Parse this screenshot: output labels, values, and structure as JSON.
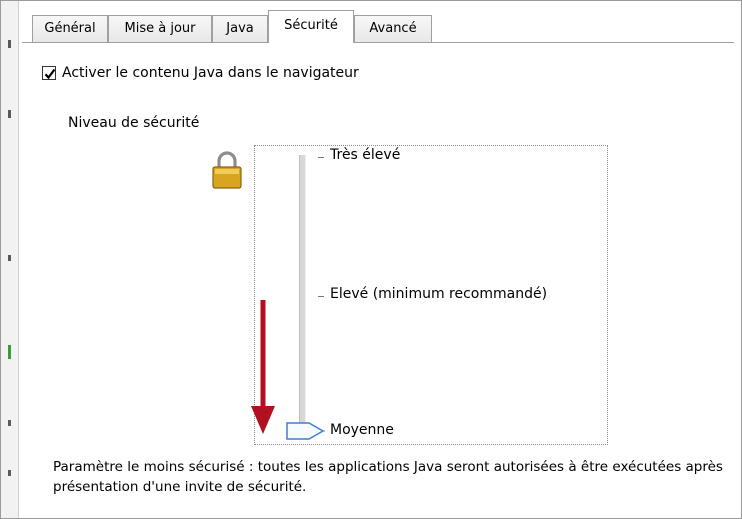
{
  "tabs": [
    {
      "label": "Général",
      "active": false
    },
    {
      "label": "Mise à jour",
      "active": false
    },
    {
      "label": "Java",
      "active": false
    },
    {
      "label": "Sécurité",
      "active": true
    },
    {
      "label": "Avancé",
      "active": false
    }
  ],
  "enable_java": {
    "checked": true,
    "label": "Activer le contenu Java dans le navigateur"
  },
  "security": {
    "section_label": "Niveau de sécurité",
    "levels": [
      "Très élevé",
      "Elevé (minimum recommandé)",
      "Moyenne"
    ],
    "selected_level": "Moyenne",
    "description": "Paramètre le moins sécurisé : toutes les applications Java seront autorisées à être exécutées après présentation d'une invite de sécurité."
  },
  "icons": {
    "lock": "lock-icon",
    "thumb": "slider-thumb-icon",
    "arrow": "arrow-down-icon"
  },
  "colors": {
    "arrow": "#b01020",
    "thumb_border": "#3f7fd0",
    "lock_gold": "#d9a41e"
  }
}
